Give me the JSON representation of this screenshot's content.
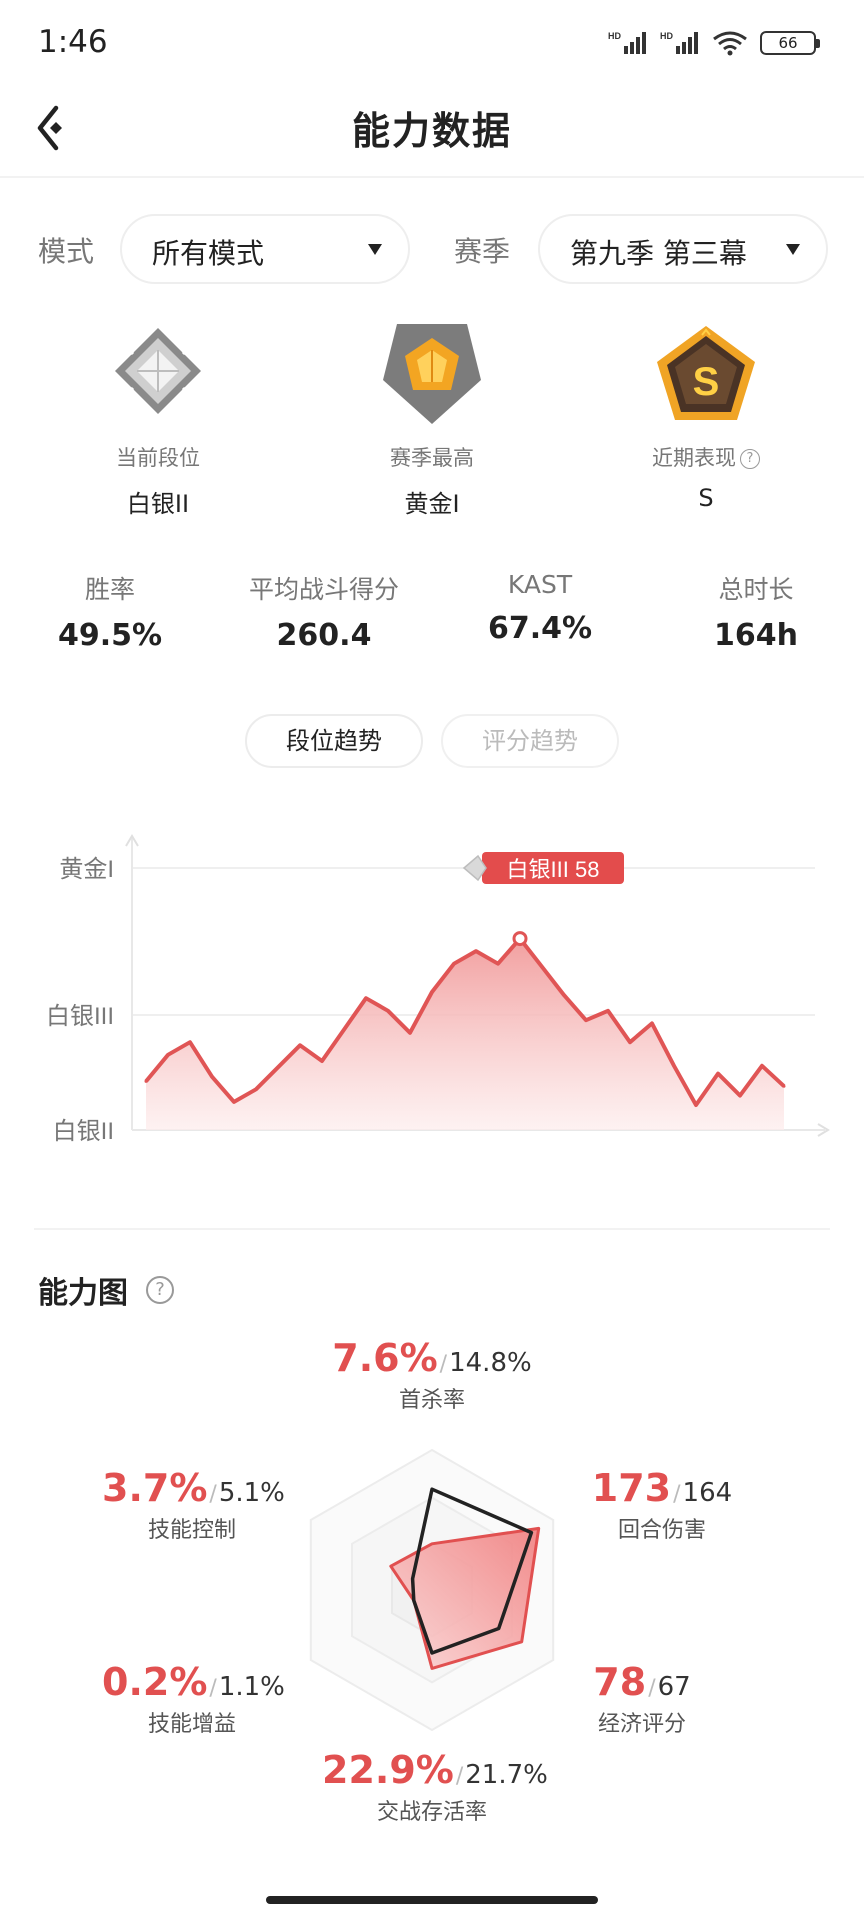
{
  "status_bar": {
    "time": "1:46",
    "battery": "66",
    "icons": [
      "hd-signal-icon",
      "hd-signal-icon",
      "wifi-icon",
      "battery-icon"
    ]
  },
  "header": {
    "title": "能力数据",
    "back_icon": "back-arrow-icon"
  },
  "filters": {
    "mode_label": "模式",
    "mode_value": "所有模式",
    "season_label": "赛季",
    "season_value": "第九季 第三幕"
  },
  "ranks": [
    {
      "label": "当前段位",
      "value": "白银II",
      "badge": "silver-rank-badge"
    },
    {
      "label": "赛季最高",
      "value": "黄金I",
      "badge": "gold-rank-badge"
    },
    {
      "label": "近期表现",
      "value": "S",
      "badge": "s-grade-badge",
      "help": "?"
    }
  ],
  "stats": [
    {
      "label": "胜率",
      "value": "49.5%"
    },
    {
      "label": "平均战斗得分",
      "value": "260.4"
    },
    {
      "label": "KAST",
      "value": "67.4%"
    },
    {
      "label": "总时长",
      "value": "164h"
    }
  ],
  "tabs": [
    {
      "label": "段位趋势",
      "active": true
    },
    {
      "label": "评分趋势",
      "active": false
    }
  ],
  "chart_data": {
    "type": "area",
    "title": "",
    "xlabel": "",
    "ylabel": "",
    "y_tick_labels": [
      "黄金I",
      "白银III",
      "白银II"
    ],
    "y_range_label": [
      "白银II",
      "黄金I"
    ],
    "series": [
      {
        "values": [
          15,
          32,
          40,
          18,
          2,
          10,
          24,
          38,
          28,
          48,
          68,
          60,
          46,
          72,
          90,
          98,
          90,
          106,
          88,
          70,
          54,
          60,
          40,
          52,
          25,
          0,
          20,
          6,
          25,
          12
        ],
        "y_max_for_scale": 100
      }
    ],
    "highlight": {
      "label": "白银III 58"
    },
    "grid": true,
    "colors": {
      "line": "#e05555",
      "fill_top": "#f19a9a",
      "fill_bottom": "#fdecec"
    }
  },
  "ability": {
    "title": "能力图",
    "help": "?",
    "metrics": [
      {
        "name": "首杀率",
        "mine": "7.6%",
        "avg": "14.8%"
      },
      {
        "name": "回合伤害",
        "mine": "173",
        "avg": "164"
      },
      {
        "name": "经济评分",
        "mine": "78",
        "avg": "67"
      },
      {
        "name": "交战存活率",
        "mine": "22.9%",
        "avg": "21.7%"
      },
      {
        "name": "技能增益",
        "mine": "0.2%",
        "avg": "1.1%"
      },
      {
        "name": "技能控制",
        "mine": "3.7%",
        "avg": "5.1%"
      }
    ],
    "sep": "/",
    "radar_levels_mine": [
      0.33,
      0.88,
      0.74,
      0.56,
      0.15,
      0.34
    ],
    "radar_levels_avg": [
      0.72,
      0.82,
      0.55,
      0.45,
      0.15,
      0.16
    ],
    "colors": {
      "mine": "#e15050",
      "avg": "#222222"
    }
  }
}
